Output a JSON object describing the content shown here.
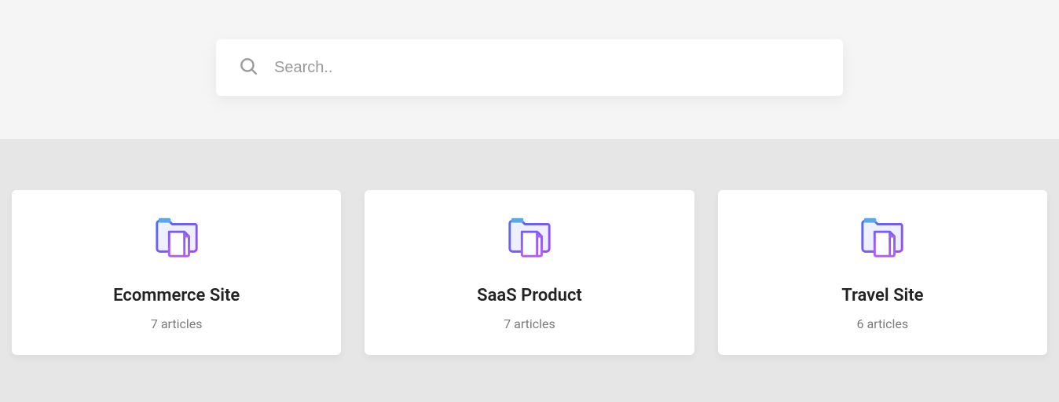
{
  "search": {
    "placeholder": "Search.."
  },
  "cards": [
    {
      "title": "Ecommerce Site",
      "subtitle": "7 articles"
    },
    {
      "title": "SaaS Product",
      "subtitle": "7 articles"
    },
    {
      "title": "Travel Site",
      "subtitle": "6 articles"
    }
  ]
}
